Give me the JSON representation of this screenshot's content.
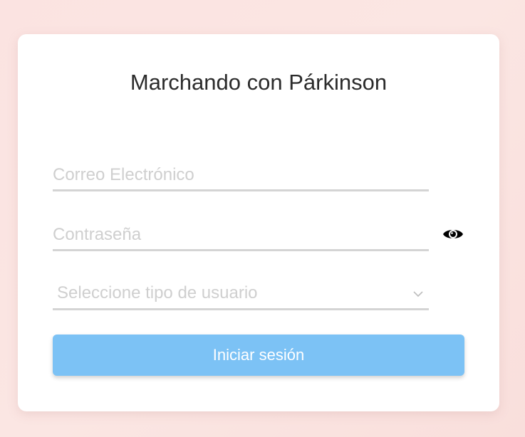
{
  "app": {
    "title": "Marchando con Párkinson"
  },
  "form": {
    "email_placeholder": "Correo Electrónico",
    "email_value": "",
    "password_placeholder": "Contraseña",
    "password_value": "",
    "user_type_placeholder": "Seleccione tipo de usuario",
    "submit_label": "Iniciar sesión"
  },
  "icons": {
    "password_toggle": "eye-icon",
    "select_toggle": "chevron-down-icon"
  },
  "colors": {
    "background": "#fbe3e1",
    "card": "#ffffff",
    "button": "#7cc2f5",
    "button_text": "#ffffff",
    "underline": "#d4d4d4",
    "placeholder": "#cfcfcf",
    "title": "#2b2b2b"
  }
}
